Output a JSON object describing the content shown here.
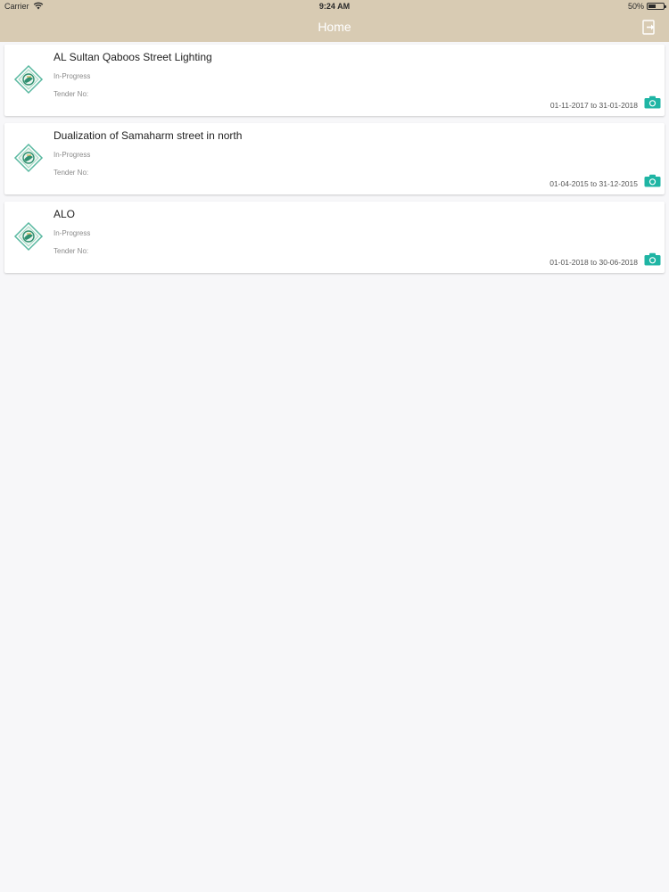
{
  "status_bar": {
    "carrier": "Carrier",
    "time": "9:24 AM",
    "battery_text": "50%",
    "battery_level": 0.5
  },
  "nav": {
    "title": "Home",
    "logout_icon": "logout-icon"
  },
  "colors": {
    "header": "#d8cbb3",
    "accent": "#1fb5a4",
    "background": "#f7f7f9"
  },
  "projects": [
    {
      "title": "AL Sultan Qaboos Street Lighting",
      "status": "In-Progress",
      "tender": "Tender No:",
      "dates": "01-11-2017 to 31-01-2018"
    },
    {
      "title": "Dualization of Samaharm street in north",
      "status": "In-Progress",
      "tender": "Tender No:",
      "dates": "01-04-2015 to 31-12-2015"
    },
    {
      "title": "ALO",
      "status": "In-Progress",
      "tender": "Tender No:",
      "dates": "01-01-2018 to 30-06-2018"
    }
  ]
}
